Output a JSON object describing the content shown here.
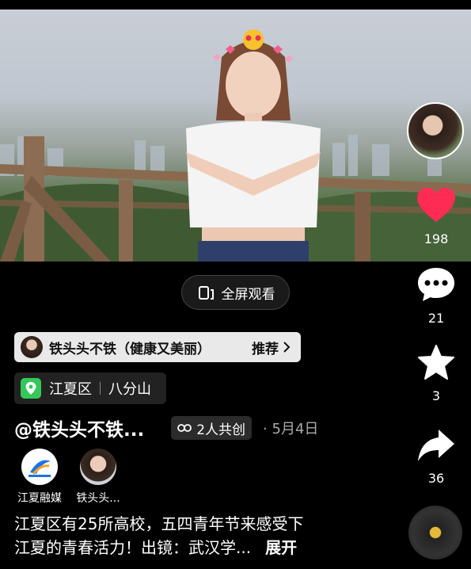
{
  "video": {
    "fullscreen_label": "全屏观看"
  },
  "recommend": {
    "label": "铁头头不铁（健康又美丽）",
    "action": "推荐"
  },
  "location": {
    "district": "江夏区",
    "place": "八分山"
  },
  "post": {
    "author": "@铁头头不铁...",
    "co_create": "2人共创",
    "date": "· 5月4日",
    "caption_line1": "江夏区有25所高校，五四青年节来感受下",
    "caption_line2": "江夏的青春活力！出镜：武汉学...",
    "expand": "展开"
  },
  "collaborators": [
    {
      "name": "江夏融媒",
      "icon": "jiangxia-media-logo"
    },
    {
      "name": "铁头头..."
    }
  ],
  "sidebar": {
    "likes": "198",
    "comments": "21",
    "favorites": "3",
    "shares": "36"
  },
  "colors": {
    "like": "#fe2c55",
    "location_pin": "#34c759",
    "disc_center": "#e6b93a"
  }
}
